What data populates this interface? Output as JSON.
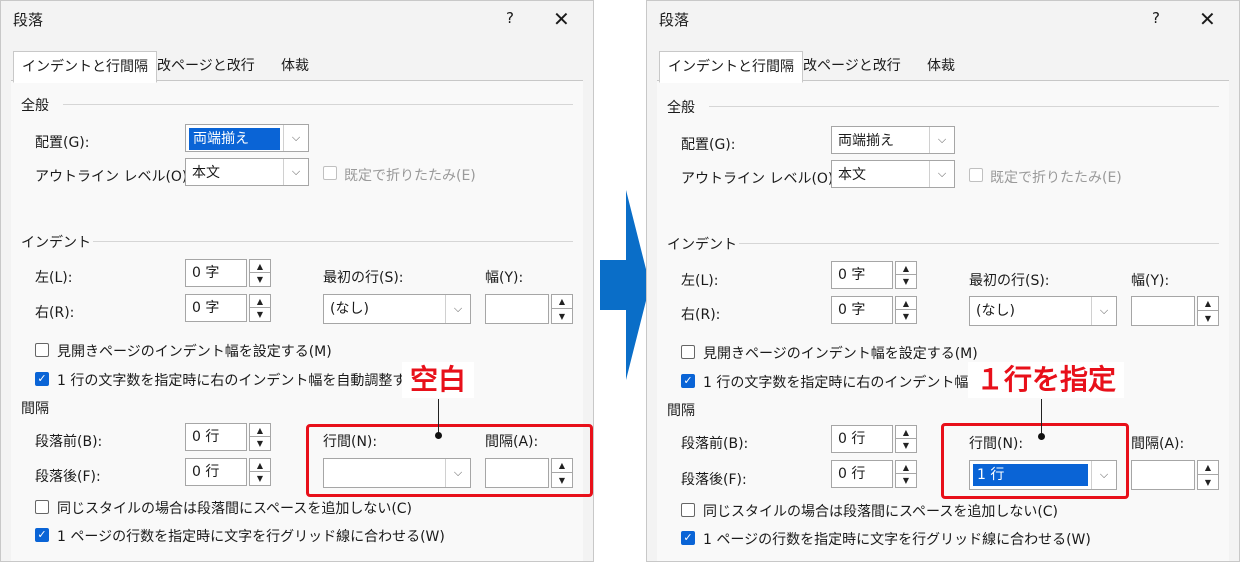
{
  "left": {
    "title": "段落",
    "help": "?",
    "close": "✕",
    "tabs": [
      "インデントと行間隔",
      "改ページと改行",
      "体裁"
    ],
    "general": {
      "section": "全般",
      "alignment_label": "配置(G):",
      "alignment_value": "両端揃え",
      "outline_label": "アウトライン レベル(O):",
      "outline_value": "本文",
      "collapsed_label": "既定で折りたたみ(E)"
    },
    "indent": {
      "section": "インデント",
      "left_label": "左(L):",
      "left_value": "0 字",
      "right_label": "右(R):",
      "right_value": "0 字",
      "first_line_label": "最初の行(S):",
      "first_line_value": "(なし)",
      "width_label": "幅(Y):",
      "width_value": "",
      "mirror_label": "見開きページのインデント幅を設定する(M)",
      "auto_label": "1 行の文字数を指定時に右のインデント幅を自動調整する"
    },
    "spacing": {
      "section": "間隔",
      "before_label": "段落前(B):",
      "before_value": "0 行",
      "after_label": "段落後(F):",
      "after_value": "0 行",
      "line_label": "行間(N):",
      "line_value": "",
      "at_label": "間隔(A):",
      "at_value": "",
      "no_space_label": "同じスタイルの場合は段落間にスペースを追加しない(C)",
      "grid_label": "1 ページの行数を指定時に文字を行グリッド線に合わせる(W)"
    },
    "callout": "空白"
  },
  "right": {
    "title": "段落",
    "help": "?",
    "close": "✕",
    "tabs": [
      "インデントと行間隔",
      "改ページと改行",
      "体裁"
    ],
    "general": {
      "section": "全般",
      "alignment_label": "配置(G):",
      "alignment_value": "両端揃え",
      "outline_label": "アウトライン レベル(O):",
      "outline_value": "本文",
      "collapsed_label": "既定で折りたたみ(E)"
    },
    "indent": {
      "section": "インデント",
      "left_label": "左(L):",
      "left_value": "0 字",
      "right_label": "右(R):",
      "right_value": "0 字",
      "first_line_label": "最初の行(S):",
      "first_line_value": "(なし)",
      "width_label": "幅(Y):",
      "width_value": "",
      "mirror_label": "見開きページのインデント幅を設定する(M)",
      "auto_label": "1 行の文字数を指定時に右のインデント幅を"
    },
    "spacing": {
      "section": "間隔",
      "before_label": "段落前(B):",
      "before_value": "0 行",
      "after_label": "段落後(F):",
      "after_value": "0 行",
      "line_label": "行間(N):",
      "line_value": "1 行",
      "at_label": "間隔(A):",
      "at_value": "",
      "no_space_label": "同じスタイルの場合は段落間にスペースを追加しない(C)",
      "grid_label": "1 ページの行数を指定時に文字を行グリッド線に合わせる(W)"
    },
    "callout": "１行を指定"
  },
  "colors": {
    "accent": "#0a64d6",
    "highlight_red": "#e8101a",
    "arrow_blue": "#0a6ec8"
  }
}
